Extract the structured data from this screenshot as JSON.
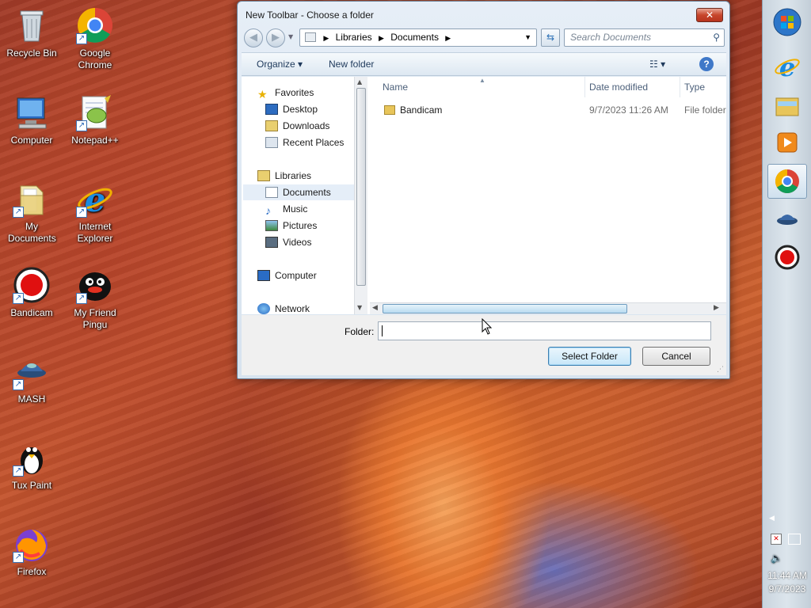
{
  "desktop": {
    "icons": [
      {
        "label": "Recycle Bin"
      },
      {
        "label": "Google Chrome"
      },
      {
        "label": "Computer"
      },
      {
        "label": "Notepad++"
      },
      {
        "label": "My Documents"
      },
      {
        "label": "Internet Explorer"
      },
      {
        "label": "Bandicam"
      },
      {
        "label": "My Friend Pingu"
      },
      {
        "label": "MASH"
      },
      {
        "label": "Tux Paint"
      },
      {
        "label": "Firefox"
      }
    ]
  },
  "dialog": {
    "title": "New Toolbar - Choose a folder",
    "close_label": "✕",
    "breadcrumb": [
      "Libraries",
      "Documents"
    ],
    "search_placeholder": "Search Documents",
    "toolbar": {
      "organize": "Organize ▾",
      "new_folder": "New folder",
      "help": "?"
    },
    "nav": {
      "favorites": "Favorites",
      "desktop": "Desktop",
      "downloads": "Downloads",
      "recent": "Recent Places",
      "libraries": "Libraries",
      "documents": "Documents",
      "music": "Music",
      "pictures": "Pictures",
      "videos": "Videos",
      "computer": "Computer",
      "network": "Network"
    },
    "columns": {
      "name": "Name",
      "date": "Date modified",
      "type": "Type"
    },
    "files": [
      {
        "name": "Bandicam",
        "date": "9/7/2023 11:26 AM",
        "type": "File folder"
      }
    ],
    "folder_label": "Folder:",
    "folder_value": "",
    "select_button": "Select Folder",
    "cancel_button": "Cancel"
  },
  "taskbar": {
    "time": "11:44 AM",
    "date": "9/7/2023"
  }
}
